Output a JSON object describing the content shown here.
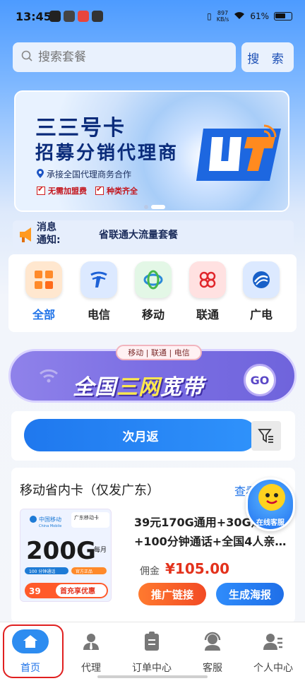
{
  "status_bar": {
    "time": "13:45",
    "net_speed_top": "897",
    "net_speed_unit": "KB/s",
    "battery": "61%"
  },
  "search": {
    "placeholder": "搜索套餐",
    "button": "搜 索"
  },
  "banner": {
    "title": "三三号卡",
    "subtitle": "招募分销代理商",
    "line": "承接全国代理商务合作",
    "tags": [
      "无需加盟费",
      "种类齐全"
    ]
  },
  "notice": {
    "label_line1": "消息",
    "label_line2": "通知:",
    "text": "省联通大流量套餐"
  },
  "categories": [
    {
      "label": "全部",
      "icon": "grid-icon",
      "color": "#ff8a2a"
    },
    {
      "label": "电信",
      "icon": "china-telecom-icon",
      "color": "#1e62d6"
    },
    {
      "label": "移动",
      "icon": "china-mobile-icon",
      "color": "#2b8ad8"
    },
    {
      "label": "联通",
      "icon": "china-unicom-icon",
      "color": "#e0262b"
    },
    {
      "label": "广电",
      "icon": "broadcast-icon",
      "color": "#1860c8"
    }
  ],
  "broadband": {
    "pill": "移动 | 联通 | 电信",
    "text_a": "全国",
    "text_b": "三网",
    "text_c": "宽带",
    "go": "GO"
  },
  "filter": {
    "button": "次月返"
  },
  "card": {
    "section_title": "移动省内卡（仅发广东）",
    "more": "查看更多",
    "product_name": "39元170G通用+30G...+100分钟通话+全国4人亲…",
    "product_name_line1": "39元170G通用+30G定",
    "product_name_line2": "+100分钟通话+全国4人亲…",
    "commission_label": "佣金",
    "commission_value": "¥105.00",
    "promo_button": "推广链接",
    "poster_button": "生成海报",
    "image": {
      "brand": "中国移动",
      "brand_en": "China Mobile",
      "card_name": "广东移动卡",
      "big": "200G",
      "per_month": "每月",
      "price": "39",
      "offer": "首充享优惠",
      "tag1": "100 分钟通话",
      "tag2": "官方正品"
    }
  },
  "service": {
    "label": "在线客服"
  },
  "bottom_nav": [
    {
      "label": "首页",
      "icon": "home-icon",
      "active": true
    },
    {
      "label": "代理",
      "icon": "agent-icon"
    },
    {
      "label": "订单中心",
      "icon": "order-icon"
    },
    {
      "label": "客服",
      "icon": "support-icon"
    },
    {
      "label": "个人中心",
      "icon": "profile-icon"
    }
  ]
}
